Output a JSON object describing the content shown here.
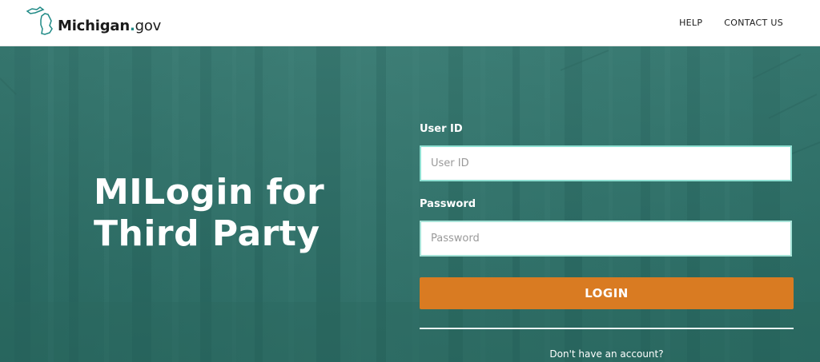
{
  "header": {
    "logo": {
      "name": "Michigan",
      "dot": ".",
      "suffix": "gov"
    },
    "nav": [
      {
        "label": "HELP"
      },
      {
        "label": "CONTACT US"
      }
    ]
  },
  "hero": {
    "title_line1": "MILogin for",
    "title_line2": "Third Party"
  },
  "form": {
    "userid": {
      "label": "User ID",
      "placeholder": "User ID",
      "value": ""
    },
    "password": {
      "label": "Password",
      "placeholder": "Password",
      "value": ""
    },
    "login_label": "LOGIN",
    "signup_text": "Don't have an account?"
  },
  "colors": {
    "hero_bg": "#2f6b64",
    "login_button": "#d97b22",
    "input_border": "#a7e3d8",
    "brand_dot": "#1f8a86"
  }
}
